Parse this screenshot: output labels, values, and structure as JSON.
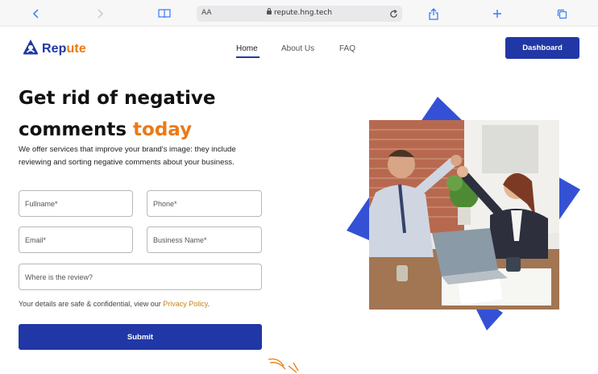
{
  "browser": {
    "text_size_label": "AA",
    "url": "repute.hng.tech",
    "icons": [
      "back-icon",
      "forward-icon",
      "book-icon",
      "lock-icon",
      "reload-icon",
      "share-icon",
      "new-tab-icon",
      "tabs-icon"
    ]
  },
  "site": {
    "logo_part1": "Rep",
    "logo_part2": "ute",
    "nav": {
      "home": "Home",
      "about": "About Us",
      "faq": "FAQ"
    },
    "dashboard_button": "Dashboard"
  },
  "hero": {
    "title_line1": "Get rid of negative",
    "title_line2_part1": "comments ",
    "title_line2_accent": "today",
    "subtitle": "We offer services that improve your brand's image: they include reviewing and sorting negative comments about your business."
  },
  "form": {
    "fullname_placeholder": "Fullname*",
    "phone_placeholder": "Phone*",
    "email_placeholder": "Email*",
    "business_placeholder": "Business Name*",
    "review_placeholder": "Where is the review?",
    "privacy_text": "Your details are safe & confidential, view our ",
    "privacy_link": "Privacy Policy",
    "privacy_end": ".",
    "submit_label": "Submit"
  },
  "colors": {
    "brand_blue": "#2137a5",
    "accent_orange": "#ea7a16",
    "diamond_blue": "#3451d6"
  }
}
